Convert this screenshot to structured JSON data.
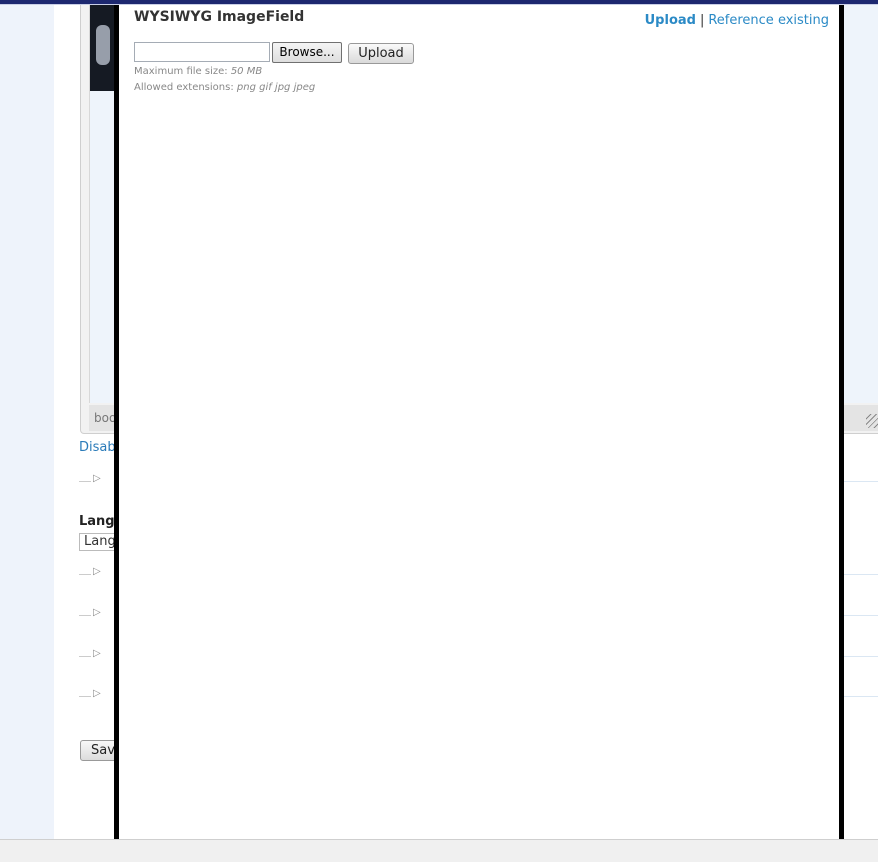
{
  "background_page": {
    "editor_status_text": "boo",
    "disable_link": "Disab",
    "language_label": "Lang",
    "language_select_value": "Lang",
    "save_button_label": "Sav"
  },
  "dialog": {
    "title": "WYSIWYG ImageField",
    "tabs": {
      "upload": "Upload",
      "separator": "|",
      "reference": "Reference existing"
    },
    "browse_label": "Browse...",
    "upload_button_label": "Upload",
    "max_size_label": "Maximum file size:",
    "max_size_value": "50 MB",
    "extensions_label": "Allowed extensions:",
    "extensions_value": "png gif jpg jpeg"
  },
  "colors": {
    "link": "#2b8ac6",
    "top_bar": "#1d2870",
    "dialog_border": "#000000"
  }
}
